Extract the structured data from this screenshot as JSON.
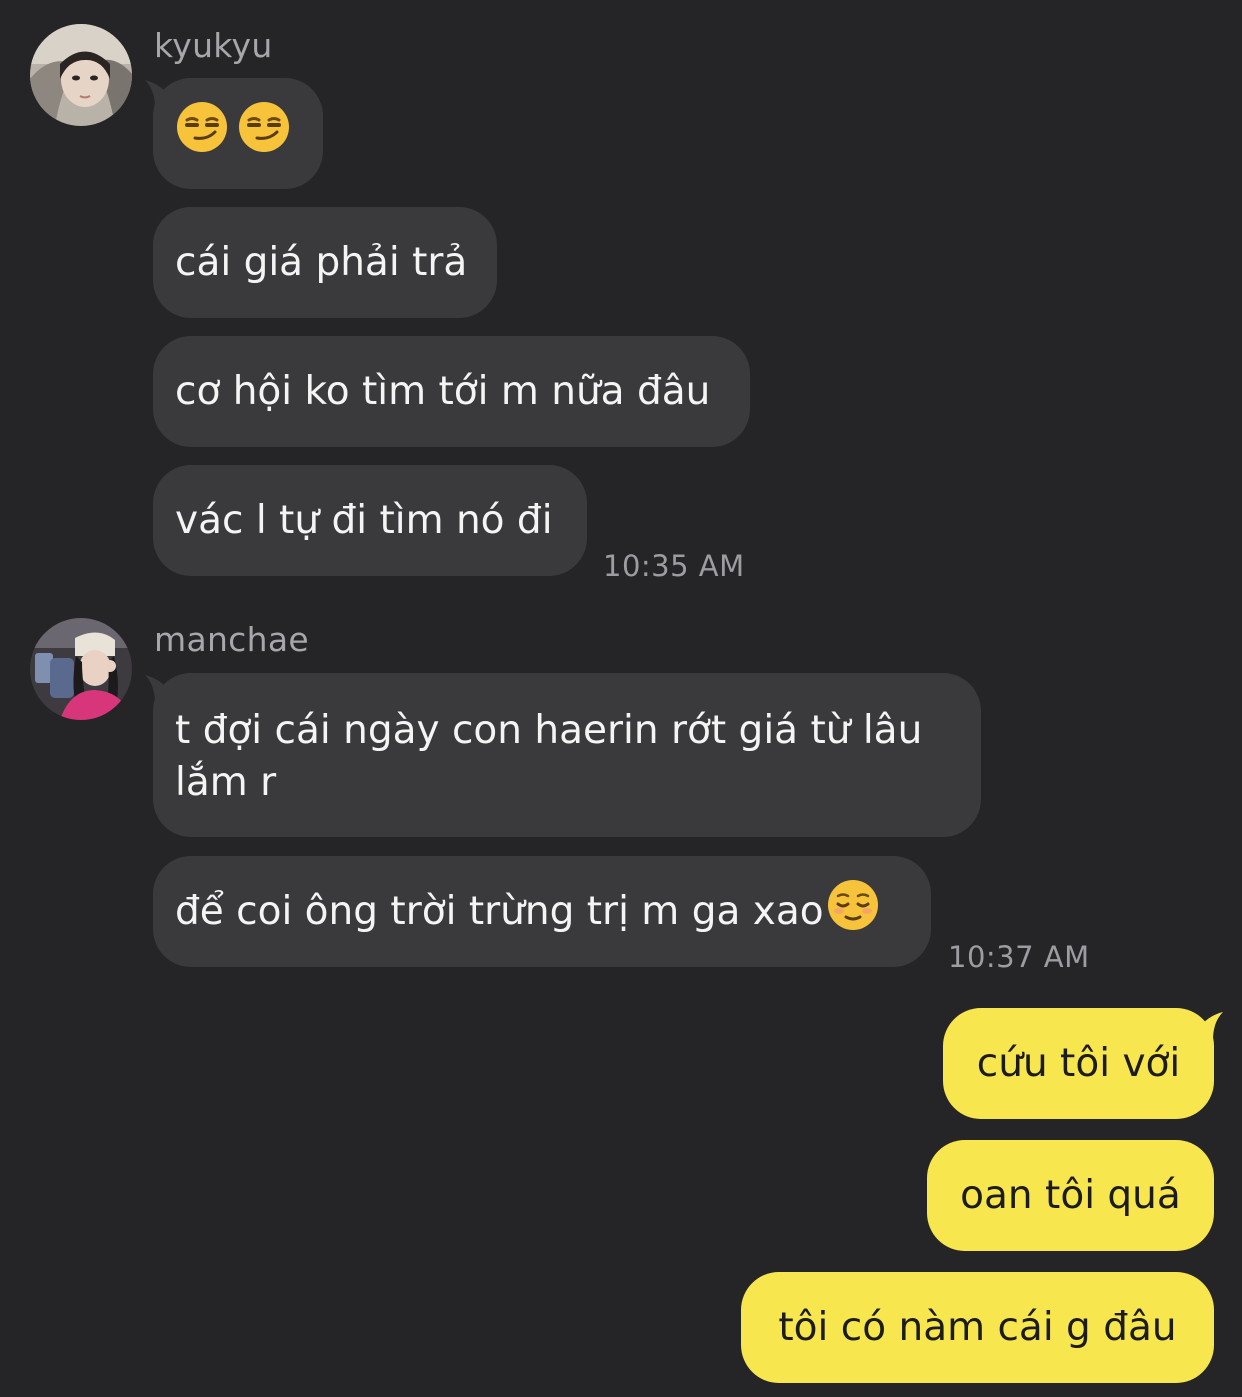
{
  "conversation": {
    "groups": [
      {
        "sender": "kyukyu",
        "avatar_icon": "kyukyu-avatar-photo",
        "messages": [
          {
            "text": "",
            "emoji": [
              "smirking-face",
              "smirking-face"
            ]
          },
          {
            "text": "cái giá phải trả"
          },
          {
            "text": "cơ hội ko tìm tới m nữa đâu"
          },
          {
            "text": "vác l tự đi tìm nó đi"
          }
        ],
        "timestamp": "10:35 AM"
      },
      {
        "sender": "manchae",
        "avatar_icon": "manchae-avatar-photo",
        "messages": [
          {
            "text": "t đợi cái ngày con haerin rớt giá từ lâu lắm r"
          },
          {
            "text": "để coi ông trời trừng trị m ga xao",
            "emoji": [
              "relieved-face"
            ]
          }
        ],
        "timestamp": "10:37 AM"
      }
    ],
    "outgoing": [
      {
        "text": "cứu tôi với"
      },
      {
        "text": "oan tôi quá"
      },
      {
        "text": "tôi có nàm cái g đâu"
      }
    ]
  },
  "colors": {
    "background": "#252527",
    "incoming_bubble": "#3a3a3c",
    "outgoing_bubble": "#f8e64f",
    "sender_name": "#a7a7ab",
    "timestamp": "#9c9ca1"
  }
}
